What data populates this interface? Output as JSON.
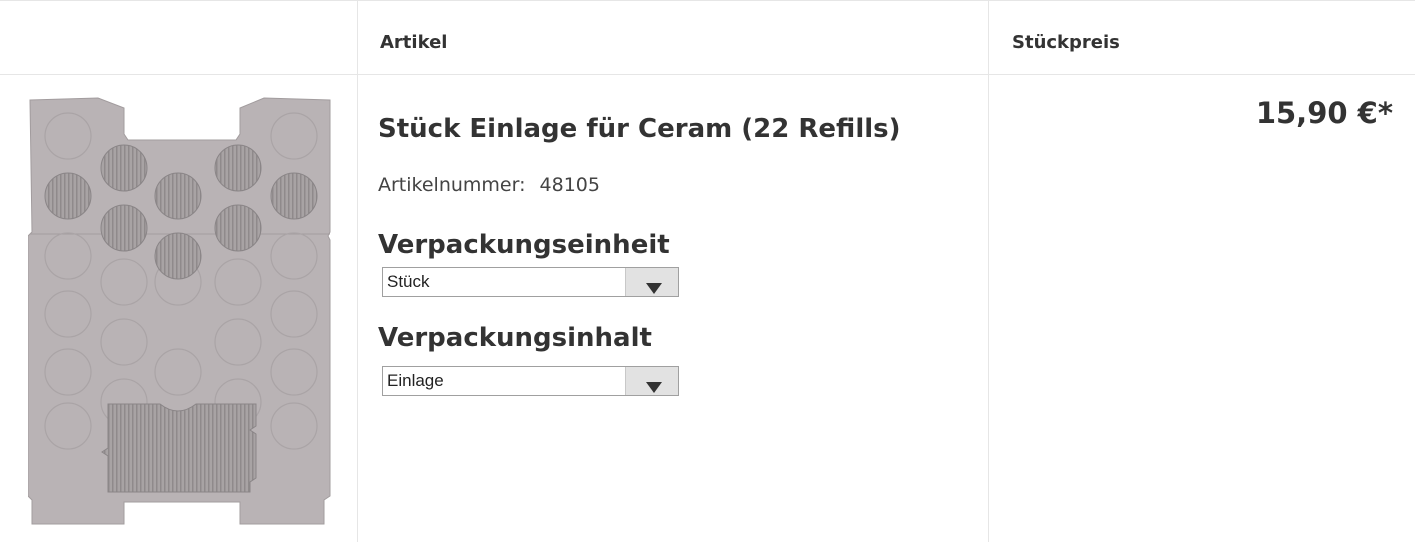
{
  "columns": {
    "image": "",
    "article": "Artikel",
    "unit_price": "Stückpreis"
  },
  "product": {
    "name": "Stück Einlage für Ceram (22 Refills)",
    "article_number_label": "Artikelnummer:",
    "article_number": "48105",
    "packaging_unit_label": "Verpackungseinheit",
    "packaging_unit_value": "Stück",
    "packaging_content_label": "Verpackungsinhalt",
    "packaging_content_value": "Einlage",
    "price": "15,90 €*",
    "image_icon": "refill-insert-tray-image"
  },
  "colors": {
    "tray": "#b9b3b5",
    "border": "#e6e6e6",
    "text": "#333333"
  }
}
